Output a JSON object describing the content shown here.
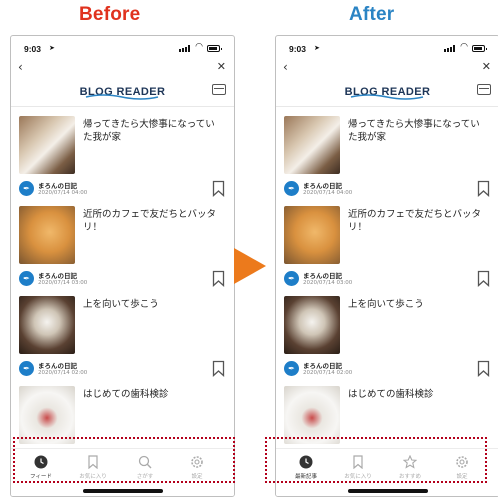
{
  "labels": {
    "before": "Before",
    "after": "After"
  },
  "colors": {
    "before": "#e0321e",
    "after": "#2b84c4",
    "arrow": "#ec7a1c",
    "frame": "#b3001b",
    "author_icon": "#1e7ec8"
  },
  "status": {
    "time": "9:03"
  },
  "brand": {
    "title": "BLOG READER"
  },
  "articles": [
    {
      "headline": "帰ってきたら大惨事になっていた我が家",
      "author": "まろんの日記",
      "date": "2020/07/14 04:00",
      "thumb": "cat"
    },
    {
      "headline": "近所のカフェで友だちとバッタリ！",
      "author": "まろんの日記",
      "date": "2020/07/14 03:00",
      "thumb": "dog"
    },
    {
      "headline": "上を向いて歩こう",
      "author": "まろんの日記",
      "date": "2020/07/14 02:00",
      "thumb": "cat"
    },
    {
      "headline": "はじめての歯科検診",
      "author": "まろんの日記",
      "date": "",
      "thumb": "dog"
    }
  ],
  "before_tabs": [
    {
      "label": "フィード",
      "icon": "clock-icon",
      "active": true
    },
    {
      "label": "お気に入り",
      "icon": "bookmark-icon",
      "active": false
    },
    {
      "label": "さがす",
      "icon": "search-icon",
      "active": false
    },
    {
      "label": "設定",
      "icon": "gear-icon",
      "active": false
    }
  ],
  "after_tabs": [
    {
      "label": "最新記事",
      "icon": "clock-icon",
      "active": true
    },
    {
      "label": "お気に入り",
      "icon": "bookmark-icon",
      "active": false
    },
    {
      "label": "おすすめ",
      "icon": "star-icon",
      "active": false
    },
    {
      "label": "設定",
      "icon": "gear-icon",
      "active": false
    }
  ]
}
